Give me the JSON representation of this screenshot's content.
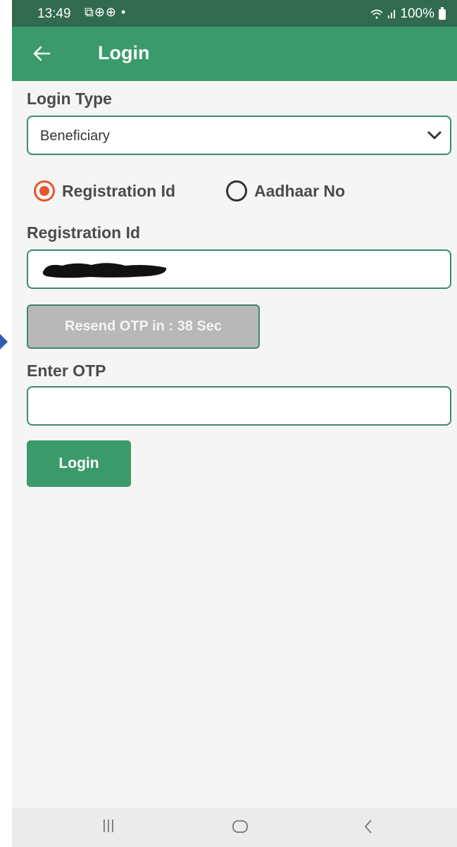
{
  "status_bar": {
    "time": "13:49",
    "notification_icons": "⧉⊕⊕ •",
    "battery": "100%"
  },
  "app_bar": {
    "title": "Login"
  },
  "form": {
    "login_type_label": "Login Type",
    "login_type_value": "Beneficiary",
    "radio_registration": "Registration Id",
    "radio_aadhaar": "Aadhaar No",
    "selected_radio": "registration",
    "registration_label": "Registration Id",
    "resend_otp": "Resend OTP in : 38 Sec",
    "otp_label": "Enter OTP",
    "otp_value": "",
    "login_button": "Login"
  },
  "colors": {
    "primary": "#3a9a6a",
    "status_bar": "#326a4f",
    "radio_selected": "#e4572e",
    "disabled_button": "#b8b8b8"
  },
  "icons": {
    "back": "back-arrow-icon",
    "dropdown": "chevron-down-icon",
    "nav_recents": "recents-icon",
    "nav_home": "home-icon",
    "nav_back": "back-icon"
  }
}
